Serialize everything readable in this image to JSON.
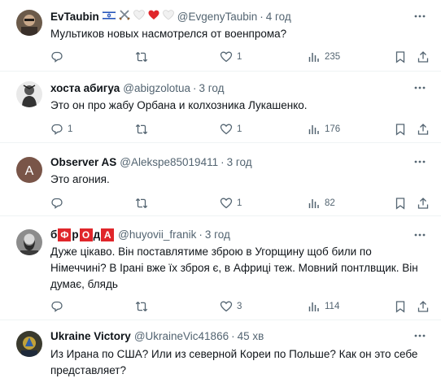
{
  "tweets": [
    {
      "name": "EvTaubin",
      "handle": "@EvgenyTaubin",
      "time": "4 год",
      "text": "Мультиков новых насмотрелся от военпрома?",
      "replies": "",
      "retweets": "",
      "likes": "1",
      "views": "235"
    },
    {
      "name": "хоста абигуа",
      "handle": "@abigzolotua",
      "time": "3 год",
      "text": "Это он про жабу Орбана и колхозника Лукашенко.",
      "replies": "1",
      "retweets": "",
      "likes": "1",
      "views": "176"
    },
    {
      "name": "Observer AS",
      "handle": "@Alekspe85019411",
      "time": "3 год",
      "avatar_letter": "A",
      "text": "Это агония.",
      "replies": "",
      "retweets": "",
      "likes": "1",
      "views": "82"
    },
    {
      "name_parts": [
        "б",
        "Ф",
        "р",
        "О",
        "д",
        "А"
      ],
      "handle": "@huyovii_franik",
      "time": "3 год",
      "text": "Дуже цікаво. Він поставлятиме зброю в Угорщину щоб били по Німеччині? В Ірані вже їх зброя є, в Африці теж. Мовний понтлвщик. Він думає, блядь",
      "replies": "",
      "retweets": "",
      "likes": "3",
      "views": "114"
    },
    {
      "name": "Ukraine Victory",
      "handle": "@UkraineVic41866",
      "time": "45 хв",
      "text": "Из Ирана по США? Или из северной Кореи по Польше? Как он это себе представляет?"
    }
  ],
  "colors": {
    "text": "#0f1419",
    "secondary": "#536471",
    "divider": "#eff3f4",
    "badge": "#e0262b"
  }
}
